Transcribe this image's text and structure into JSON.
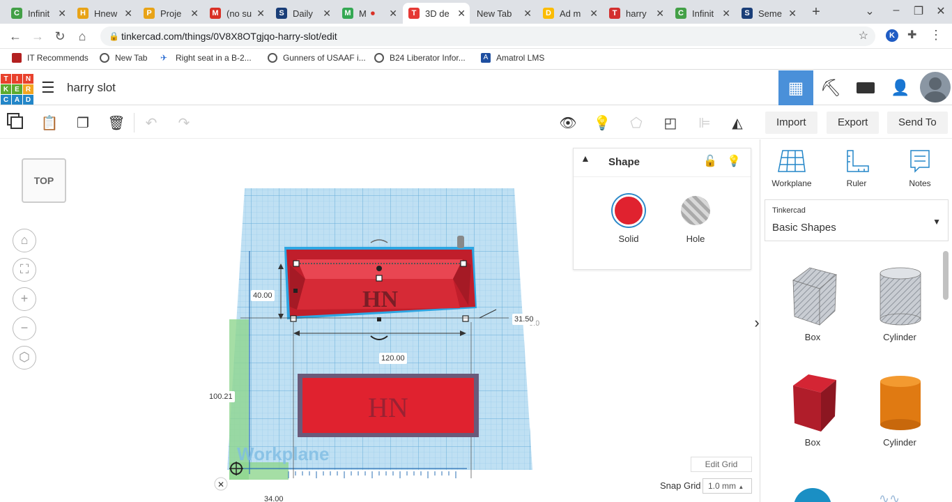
{
  "browser": {
    "tabs": [
      {
        "title": "Infinit",
        "favicon_color": "#43a047",
        "favicon_glyph": "C"
      },
      {
        "title": "Hnew",
        "favicon_color": "#e8a317",
        "favicon_glyph": "H"
      },
      {
        "title": "Proje",
        "favicon_color": "#e8a317",
        "favicon_glyph": "P"
      },
      {
        "title": "(no su",
        "favicon_color": "#d93025",
        "favicon_glyph": "M"
      },
      {
        "title": "Daily",
        "favicon_color": "#1a3e78",
        "favicon_glyph": "S"
      },
      {
        "title": "M",
        "favicon_color": "#34a853",
        "favicon_glyph": "M"
      },
      {
        "title": "3D de",
        "favicon_color": "#e53935",
        "favicon_glyph": "T"
      },
      {
        "title": "New Tab",
        "favicon_color": "",
        "favicon_glyph": ""
      },
      {
        "title": "Ad m",
        "favicon_color": "#fbbc04",
        "favicon_glyph": "D"
      },
      {
        "title": "harry",
        "favicon_color": "#d32f2f",
        "favicon_glyph": "T"
      },
      {
        "title": "Infinit",
        "favicon_color": "#43a047",
        "favicon_glyph": "C"
      },
      {
        "title": "Seme",
        "favicon_color": "#1a3e78",
        "favicon_glyph": "S"
      }
    ],
    "url": "tinkercad.com/things/0V8X8OTgjqo-harry-slot/edit",
    "bookmarks": [
      "IT Recommends",
      "New Tab",
      "Right seat in a B-2...",
      "Gunners of USAAF i...",
      "B24 Liberator Infor...",
      "Amatrol LMS"
    ]
  },
  "tinkercad": {
    "logo_letters": [
      "T",
      "I",
      "N",
      "K",
      "E",
      "R",
      "C",
      "A",
      "D"
    ],
    "design_title": "harry slot",
    "toolbar_right": {
      "import": "Import",
      "export": "Export",
      "send_to": "Send To"
    },
    "viewcube_label": "TOP",
    "workspace": {
      "workplane_label": "Workplane",
      "dims": {
        "height": "40.00",
        "right": "31.50",
        "right_under": "0.0",
        "width": "120.00",
        "length": "100.21",
        "bottom": "34.00"
      },
      "logo_text": "HN"
    },
    "shape_panel": {
      "title": "Shape",
      "solid": "Solid",
      "hole": "Hole",
      "solid_color": "#e0222f"
    },
    "edit_grid": "Edit Grid",
    "snap_grid": {
      "label": "Snap Grid",
      "value": "1.0 mm"
    },
    "sidebar": {
      "tools": [
        {
          "label": "Workplane",
          "icon": "workplane-icon"
        },
        {
          "label": "Ruler",
          "icon": "ruler-icon"
        },
        {
          "label": "Notes",
          "icon": "notes-icon"
        }
      ],
      "library_source": "Tinkercad",
      "library_value": "Basic Shapes",
      "shapes": [
        {
          "label": "Box"
        },
        {
          "label": "Cylinder"
        },
        {
          "label": "Box"
        },
        {
          "label": "Cylinder"
        }
      ]
    }
  }
}
